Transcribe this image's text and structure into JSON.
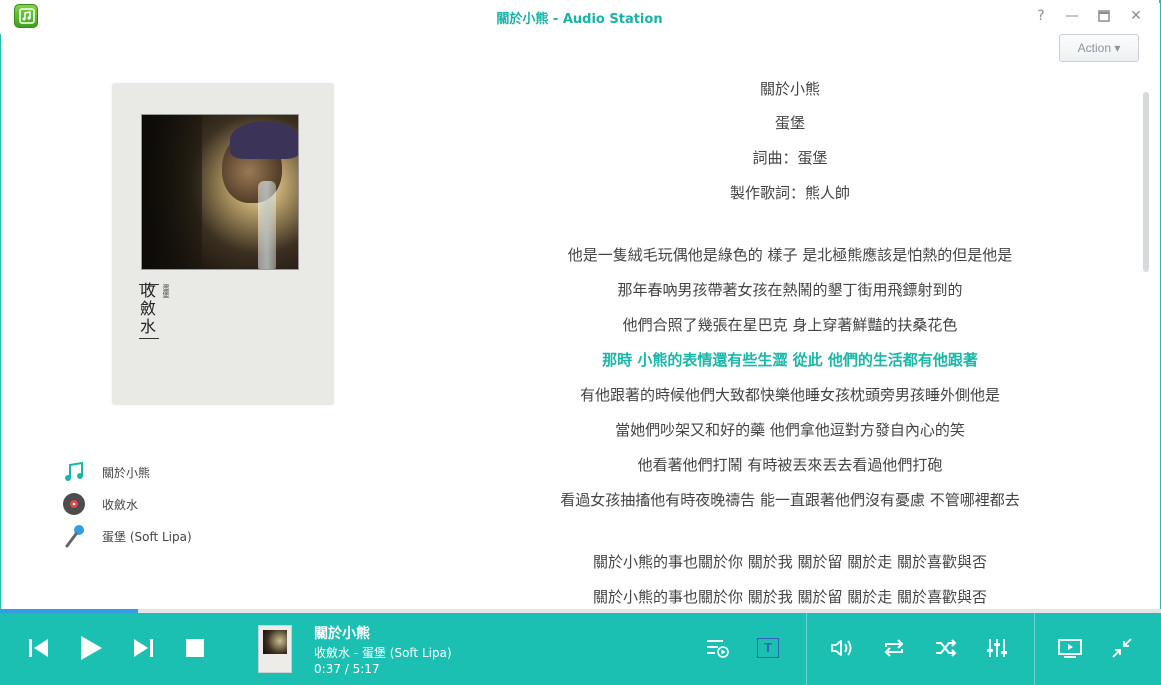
{
  "window": {
    "title": "關於小熊 - Audio Station",
    "help_label": "?",
    "minimize_label": "—",
    "close_label": "✕"
  },
  "action_button": {
    "label": "Action ▾"
  },
  "album_art": {
    "cover_title": "收斂水",
    "cover_artist": "蛋堡"
  },
  "track_info": {
    "song": "關於小熊",
    "album": "收斂水",
    "artist": "蛋堡 (Soft Lipa)"
  },
  "lyrics": {
    "lines": [
      {
        "text": "關於小熊",
        "active": false
      },
      {
        "text": "蛋堡",
        "active": false
      },
      {
        "text": "詞曲：蛋堡",
        "active": false
      },
      {
        "text": "製作歌詞：熊人帥",
        "active": false
      },
      {
        "text": "",
        "active": false
      },
      {
        "text": "他是一隻絨毛玩偶他是綠色的 樣子 是北極熊應該是怕熱的但是他是",
        "active": false
      },
      {
        "text": "那年春吶男孩帶著女孩在熱鬧的墾丁街用飛鏢射到的",
        "active": false
      },
      {
        "text": "他們合照了幾張在星巴克 身上穿著鮮豔的扶桑花色",
        "active": false
      },
      {
        "text": "那時 小熊的表情還有些生澀 從此 他們的生活都有他跟著",
        "active": true
      },
      {
        "text": "有他跟著的時候他們大致都快樂他睡女孩枕頭旁男孩睡外側他是",
        "active": false
      },
      {
        "text": "當她們吵架又和好的藥 他們拿他逗對方發自內心的笑",
        "active": false
      },
      {
        "text": "他看著他們打鬧 有時被丟來丟去看過他們打砲",
        "active": false
      },
      {
        "text": "看過女孩抽搐他有時夜晚禱告 能一直跟著他們沒有憂慮 不管哪裡都去",
        "active": false
      },
      {
        "text": "",
        "active": false
      },
      {
        "text": "關於小熊的事也關於你 關於我 關於留 關於走 關於喜歡與否",
        "active": false
      },
      {
        "text": "關於小熊的事也關於你 關於我 關於留 關於走 關於喜歡與否",
        "active": false
      }
    ]
  },
  "player": {
    "progress": 0.119,
    "now_playing": {
      "title": "關於小熊",
      "subtitle": "收斂水 - 蛋堡 (Soft Lipa)",
      "time": "0:37 / 5:17"
    },
    "lyrics_toggle_label": "T"
  },
  "colors": {
    "accent": "#1cc0b2",
    "lyric_active": "#1ab7a8",
    "progress": "#2f9ee6"
  }
}
